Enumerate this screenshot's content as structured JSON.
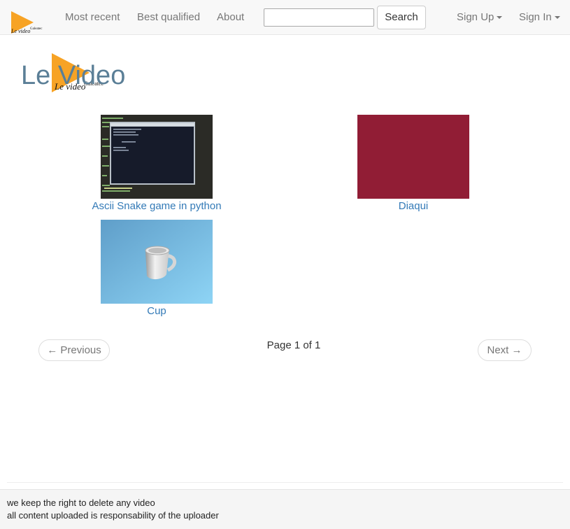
{
  "navbar": {
    "brand_logo": {
      "icon": "orange-play-triangle-logo",
      "text": "Le video",
      "subtext": "Galeatec"
    },
    "links": [
      "Most recent",
      "Best qualified",
      "About"
    ],
    "search": {
      "value": "",
      "placeholder": "",
      "button_label": "Search"
    },
    "sign_up": "Sign Up",
    "sign_in": "Sign In"
  },
  "header": {
    "title": "Le Video",
    "logo": {
      "icon": "orange-play-triangle-logo",
      "text": "Le video",
      "subtext": "Galeatec"
    }
  },
  "videos": [
    {
      "title": "Ascii Snake game in python",
      "thumbnail": "terminal-screenshot"
    },
    {
      "title": "Diaqui",
      "thumbnail": "solid-crimson",
      "color": "#911d35"
    },
    {
      "title": "Cup",
      "thumbnail": "white-cup-on-blue"
    }
  ],
  "pager": {
    "previous": "← Previous",
    "page_info": "Page 1 of 1",
    "next": "Next →"
  },
  "footer": {
    "line1": "we keep the right to delete any video",
    "line2": "all content uploaded is responsability of the uploader"
  },
  "colors": {
    "link": "#337ab7",
    "logo_orange": "#f7a325",
    "logo_title": "#5b7f97",
    "navbar_bg": "#f8f8f8"
  }
}
